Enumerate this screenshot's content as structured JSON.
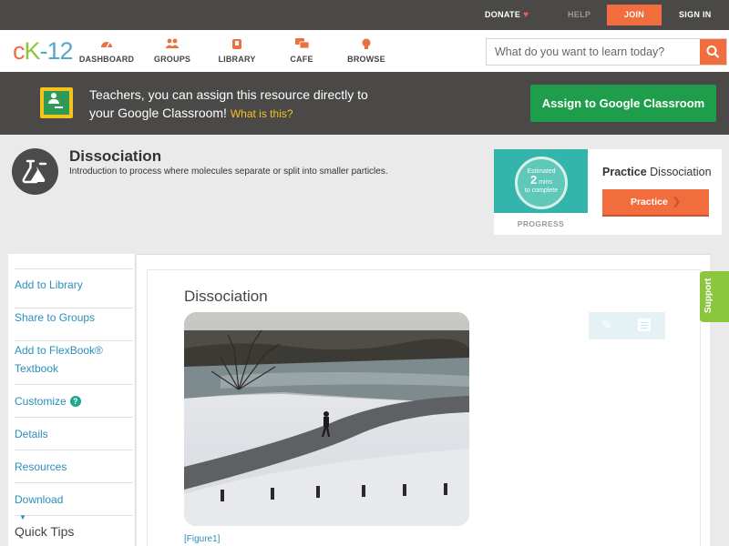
{
  "topbar": {
    "donate": "DONATE",
    "help": "HELP",
    "join": "JOIN",
    "signin": "SIGN IN"
  },
  "brand": {
    "logo_c": "c",
    "logo_k": "K",
    "logo_12": "-12",
    "accent": "#f26d3d",
    "green": "#8cc63f"
  },
  "nav": {
    "items": [
      {
        "label": "DASHBOARD",
        "icon": "dashboard-icon"
      },
      {
        "label": "GROUPS",
        "icon": "groups-icon"
      },
      {
        "label": "LIBRARY",
        "icon": "library-icon"
      },
      {
        "label": "CAFE",
        "icon": "cafe-icon"
      },
      {
        "label": "BROWSE",
        "icon": "browse-icon"
      }
    ],
    "search_placeholder": "What do you want to learn today?"
  },
  "banner": {
    "text_line1": "Teachers, you can assign this resource directly to",
    "text_line2": "your Google Classroom!",
    "what_link": "What is this?",
    "assign_button": "Assign to Google Classroom"
  },
  "concept": {
    "title": "Dissociation",
    "description": "Introduction to process where molecules separate or split into smaller particles."
  },
  "practice": {
    "progress_estimated": "Estimated",
    "progress_value": "2",
    "progress_unit": "mins",
    "progress_tail": "to complete",
    "progress_label": "PROGRESS",
    "label_bold": "Practice",
    "label_rest": "Dissociation",
    "button": "Practice"
  },
  "sidebar": {
    "items": [
      {
        "label": "Add to Library"
      },
      {
        "label": "Share to Groups"
      },
      {
        "label": "Add to FlexBook® Textbook"
      },
      {
        "label": "Customize"
      },
      {
        "label": "Details"
      },
      {
        "label": "Resources"
      },
      {
        "label": "Download"
      }
    ],
    "quick_tips": "Quick Tips"
  },
  "article": {
    "title": "Dissociation",
    "figure_caption": "[Figure1]"
  },
  "support": "Support"
}
